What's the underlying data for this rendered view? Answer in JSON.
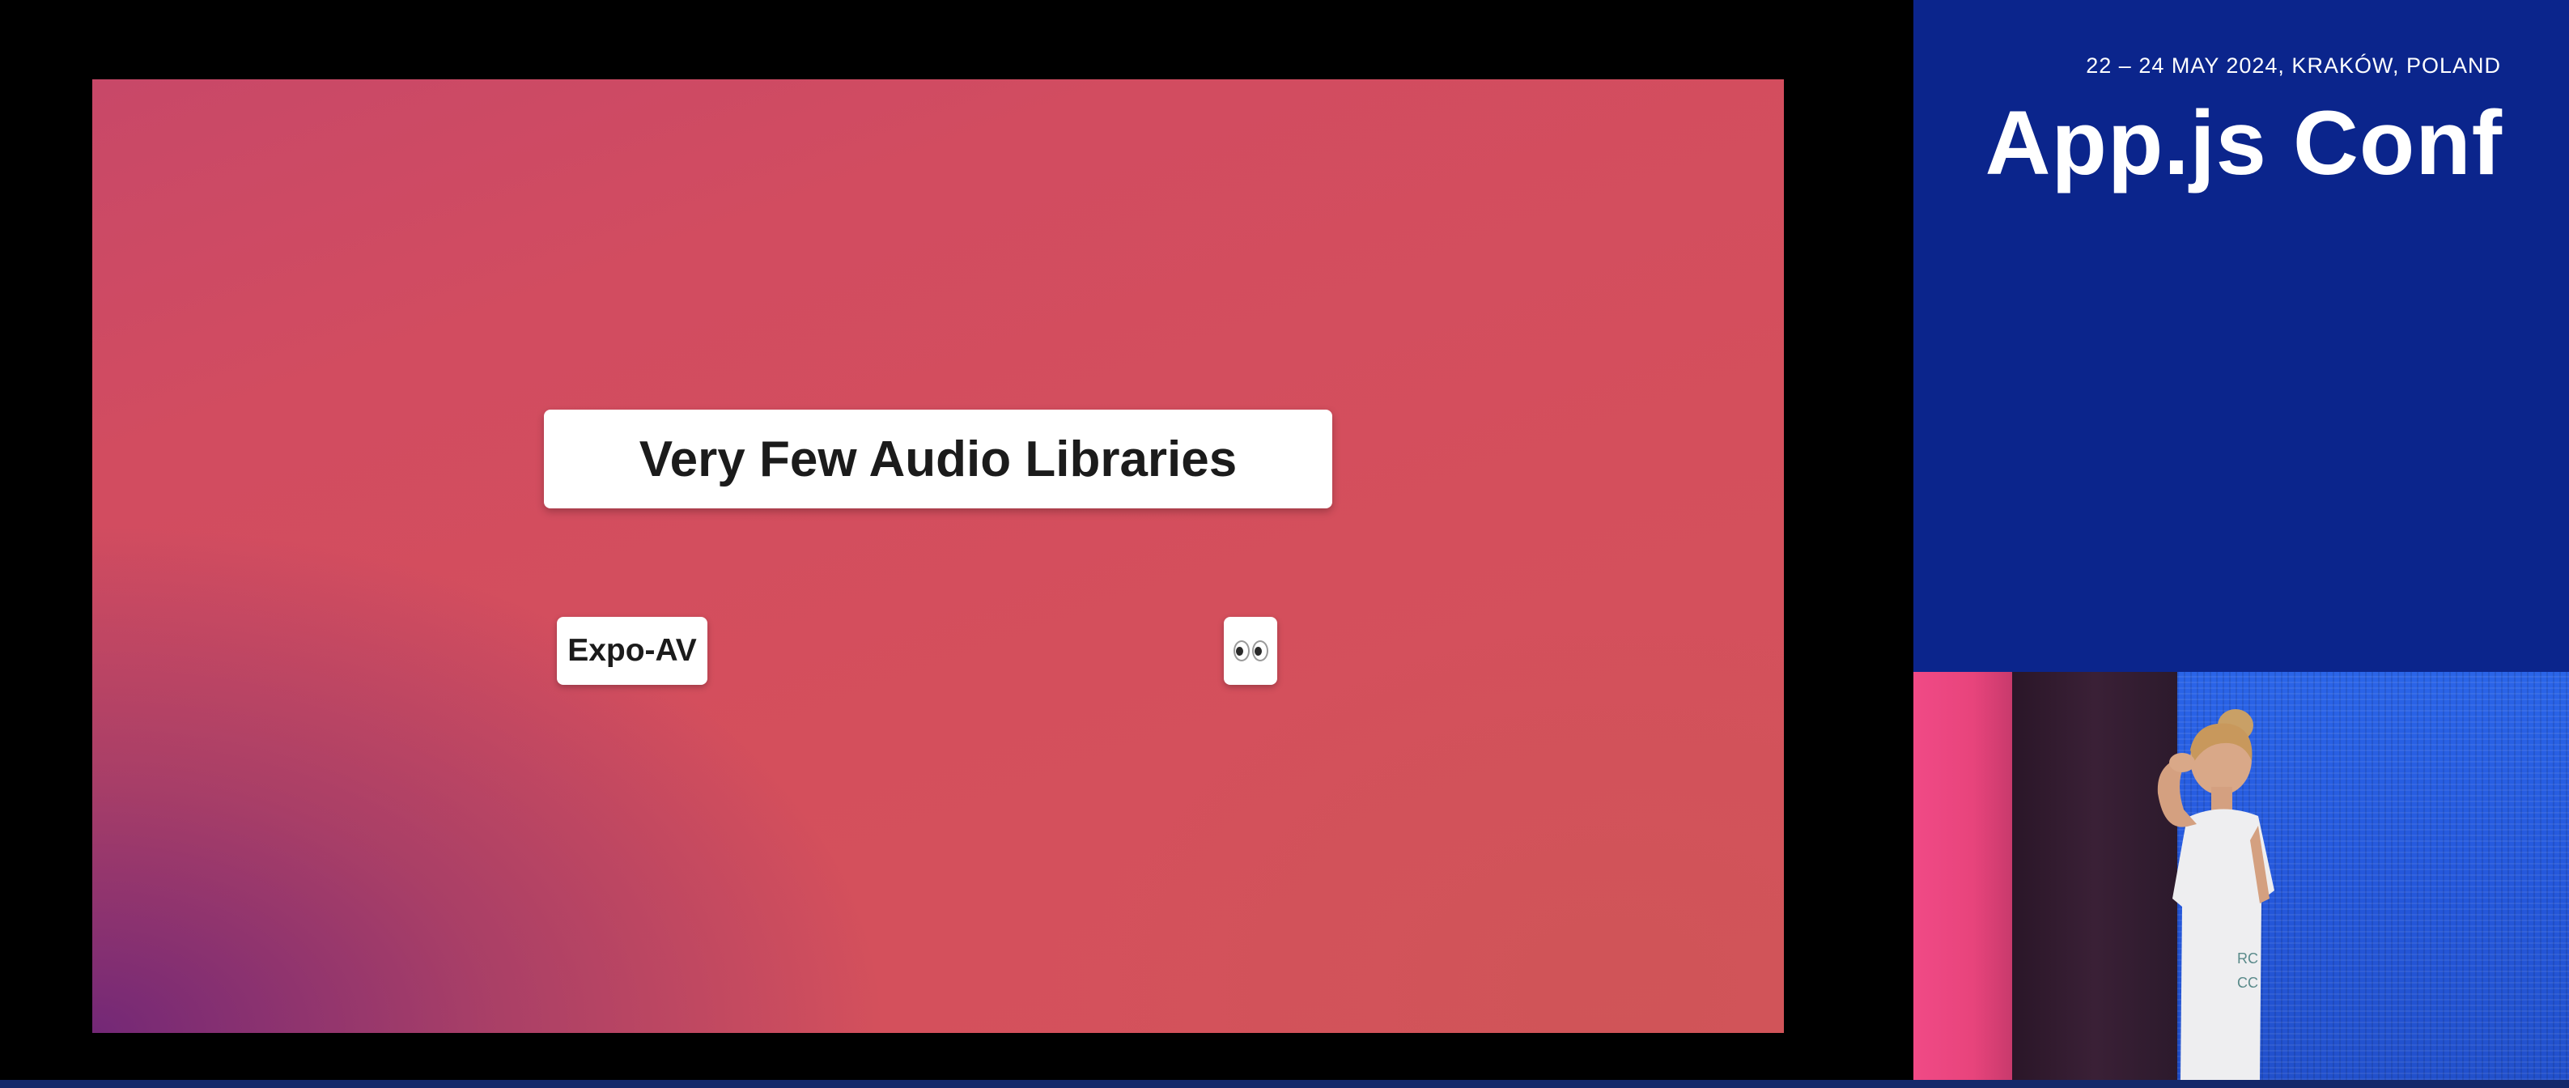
{
  "slide": {
    "title": "Very Few Audio Libraries",
    "items": [
      {
        "label": "Expo-AV"
      },
      {
        "label": "",
        "icon": "eyes-emoji-icon"
      }
    ]
  },
  "conference": {
    "date_location": "22 – 24 MAY 2024, KRAKÓW, POLAND",
    "name": "App.js Conf"
  },
  "colors": {
    "panel_blue": "#0b258c",
    "slide_red": "#d44f5c",
    "slide_purple": "#6e2678"
  }
}
